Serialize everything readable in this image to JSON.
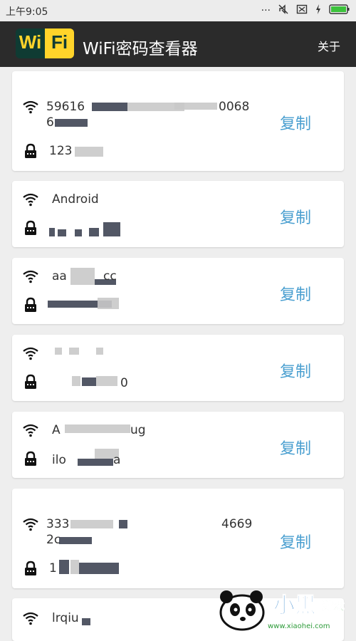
{
  "status_bar": {
    "time": "上午9:05"
  },
  "app": {
    "logo_left": "Wi",
    "logo_right": "Fi",
    "title": "WiFi密码查看器",
    "about_label": "关于"
  },
  "networks": [
    {
      "ssid_line1": "59616",
      "ssid_line1_tail": "0068",
      "ssid_line2": "6",
      "password": "123",
      "copy_label": "复制"
    },
    {
      "ssid": "Android",
      "password": "",
      "copy_label": "复制"
    },
    {
      "ssid": "aa",
      "ssid_tail": "cc",
      "password": "",
      "copy_label": "复制"
    },
    {
      "ssid": "",
      "password": "0",
      "copy_label": "复制"
    },
    {
      "ssid": "A",
      "ssid_tail": "ug",
      "password": "ilo",
      "password_tail": "a",
      "copy_label": "复制"
    },
    {
      "ssid_line1": "333",
      "ssid_line1_tail": "4669",
      "ssid_line2": "2c",
      "password": "1",
      "copy_label": "复制"
    },
    {
      "ssid": "lrqiu",
      "copy_label": ""
    }
  ],
  "watermark": {
    "text": "小黑游戏",
    "url": "www.xiaohei.com"
  },
  "colors": {
    "appbar": "#2b2b2b",
    "accent": "#4a9fd0",
    "logo_dark": "#0f3b33",
    "logo_yellow": "#ffd42a"
  }
}
